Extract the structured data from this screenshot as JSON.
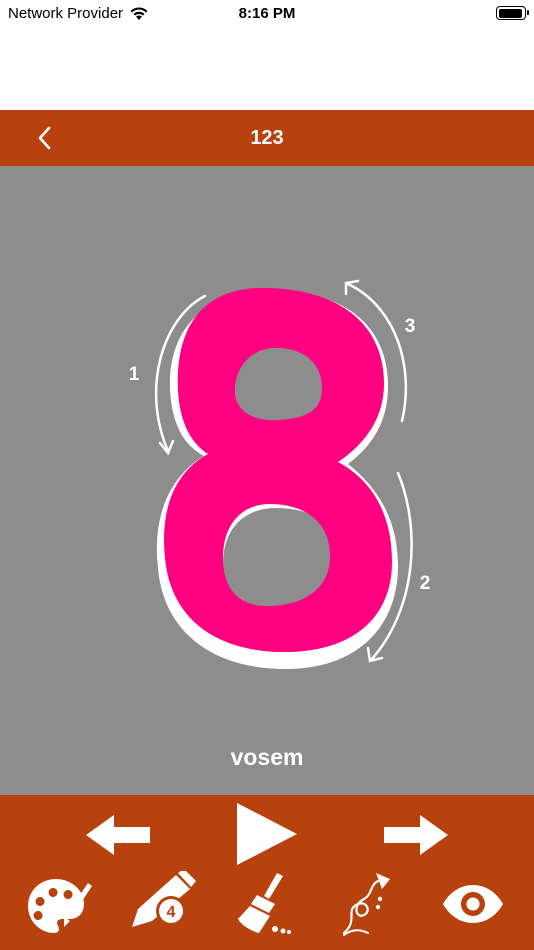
{
  "status_bar": {
    "carrier": "Network Provider",
    "time": "8:16 PM",
    "battery_level": 0.95
  },
  "nav_bar": {
    "title": "123",
    "back_icon": "chevron-left-icon"
  },
  "lesson": {
    "digit": "8",
    "word": "vosem",
    "stroke_labels": [
      "1",
      "2",
      "3"
    ],
    "ink_color": "#ff0080"
  },
  "toolbar": {
    "row1": [
      "previous-arrow-icon",
      "play-icon",
      "next-arrow-icon"
    ],
    "row2": [
      "palette-icon",
      "pencil-icon",
      "broom-icon",
      "trace-path-icon",
      "eye-icon"
    ],
    "pencil_badge": "4"
  },
  "colors": {
    "brand": "#b8420e",
    "canvas": "#8d8d8d",
    "white": "#ffffff"
  }
}
